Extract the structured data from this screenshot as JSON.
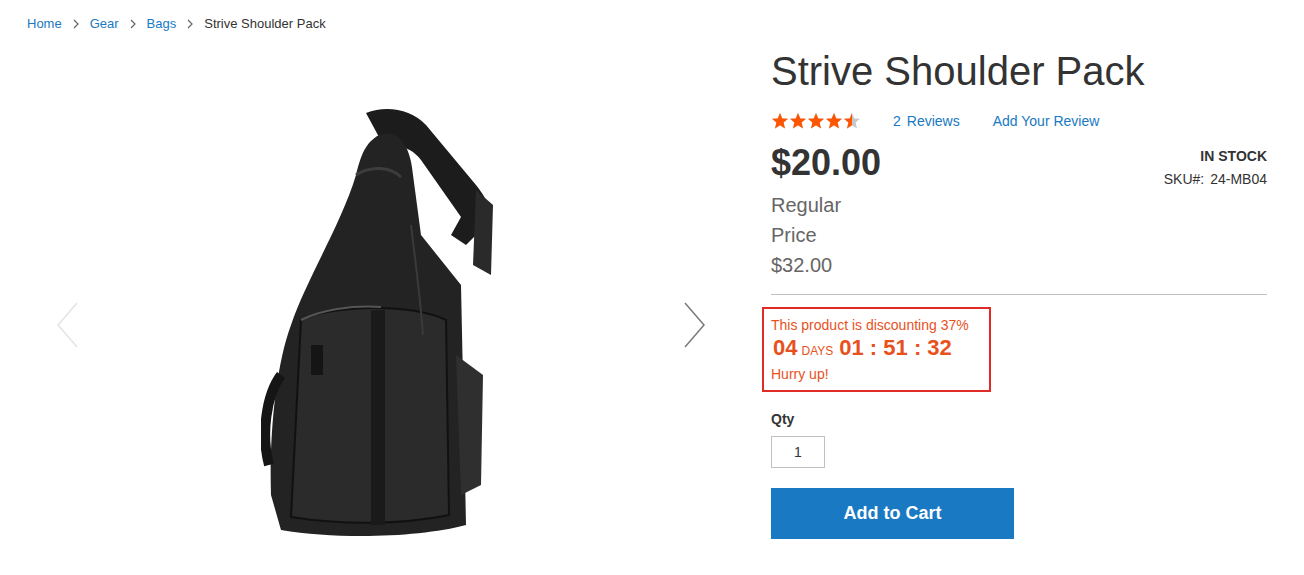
{
  "breadcrumbs": [
    {
      "label": "Home",
      "current": false
    },
    {
      "label": "Gear",
      "current": false
    },
    {
      "label": "Bags",
      "current": false
    },
    {
      "label": "Strive Shoulder Pack",
      "current": true
    }
  ],
  "product": {
    "title": "Strive Shoulder Pack",
    "rating": {
      "stars": 4.5
    },
    "reviews": {
      "count": "2",
      "label": "Reviews"
    },
    "add_review": "Add Your Review",
    "price": "$20.00",
    "regular_price_label": "Regular Price",
    "regular_price": "$32.00",
    "stock": "IN STOCK",
    "sku_label": "SKU#:",
    "sku": "24-MB04"
  },
  "countdown": {
    "message": "This product is discounting 37%",
    "days": "04",
    "days_label": "DAYS",
    "time": "01 : 51 : 32",
    "hurry": "Hurry up!"
  },
  "qty": {
    "label": "Qty",
    "value": "1"
  },
  "button": "Add to Cart"
}
